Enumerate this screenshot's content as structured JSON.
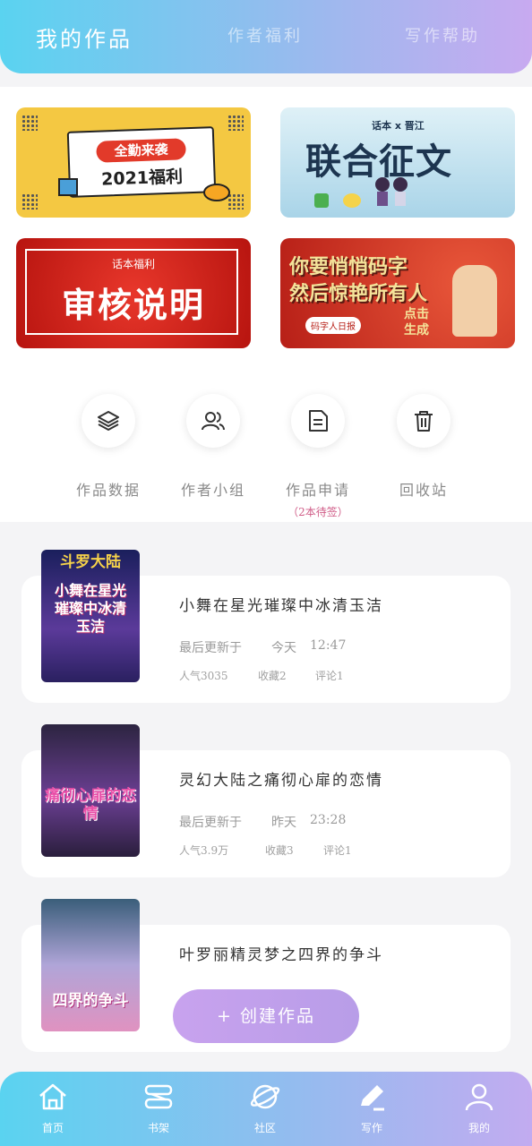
{
  "header": {
    "tabs": [
      {
        "label": "我的作品",
        "active": true
      },
      {
        "label": "作者福利",
        "active": false
      },
      {
        "label": "写作帮助",
        "active": false
      }
    ]
  },
  "banners": {
    "b1": {
      "line1": "全勤来袭",
      "line2": "2021福利"
    },
    "b2": {
      "sub": "话本 x 晋江",
      "title": "联合征文"
    },
    "b3": {
      "small": "话本福利",
      "big": "审核说明"
    },
    "b4": {
      "line1": "你要悄悄码字",
      "line2": "然后惊艳所有人",
      "tag": "码字人日报",
      "cta": "点击生成"
    }
  },
  "quick_actions": [
    {
      "label": "作品数据",
      "icon": "layers-icon"
    },
    {
      "label": "作者小组",
      "icon": "group-icon"
    },
    {
      "label": "作品申请",
      "icon": "document-icon",
      "sub": "（2本待签）"
    },
    {
      "label": "回收站",
      "icon": "trash-icon"
    }
  ],
  "works": [
    {
      "title": "小舞在星光璀璨中冰清玉洁",
      "updated_label": "最后更新于",
      "updated_day": "今天",
      "updated_time": "12:47",
      "popularity": "人气3035",
      "favorites": "收藏2",
      "comments": "评论1",
      "cover_top": "斗罗大陆",
      "cover_main": "小舞在星光璀璨中冰清玉洁"
    },
    {
      "title": "灵幻大陆之痛彻心扉的恋情",
      "updated_label": "最后更新于",
      "updated_day": "昨天",
      "updated_time": "23:28",
      "popularity": "人气3.9万",
      "favorites": "收藏3",
      "comments": "评论1",
      "cover_main": "痛彻心扉的恋情"
    },
    {
      "title": "叶罗丽精灵梦之四界的争斗",
      "cover_main": "四界的争斗"
    }
  ],
  "fab": {
    "label": "+ 创建作品"
  },
  "tabbar": [
    {
      "label": "首页",
      "icon": "home-icon"
    },
    {
      "label": "书架",
      "icon": "bookshelf-icon"
    },
    {
      "label": "社区",
      "icon": "planet-icon"
    },
    {
      "label": "写作",
      "icon": "pen-icon",
      "active": true
    },
    {
      "label": "我的",
      "icon": "user-icon"
    }
  ],
  "colors": {
    "accent_start": "#5ad3f0",
    "accent_end": "#c8aaf0",
    "fab": "#c8a2ee",
    "pending": "#d05d88"
  }
}
